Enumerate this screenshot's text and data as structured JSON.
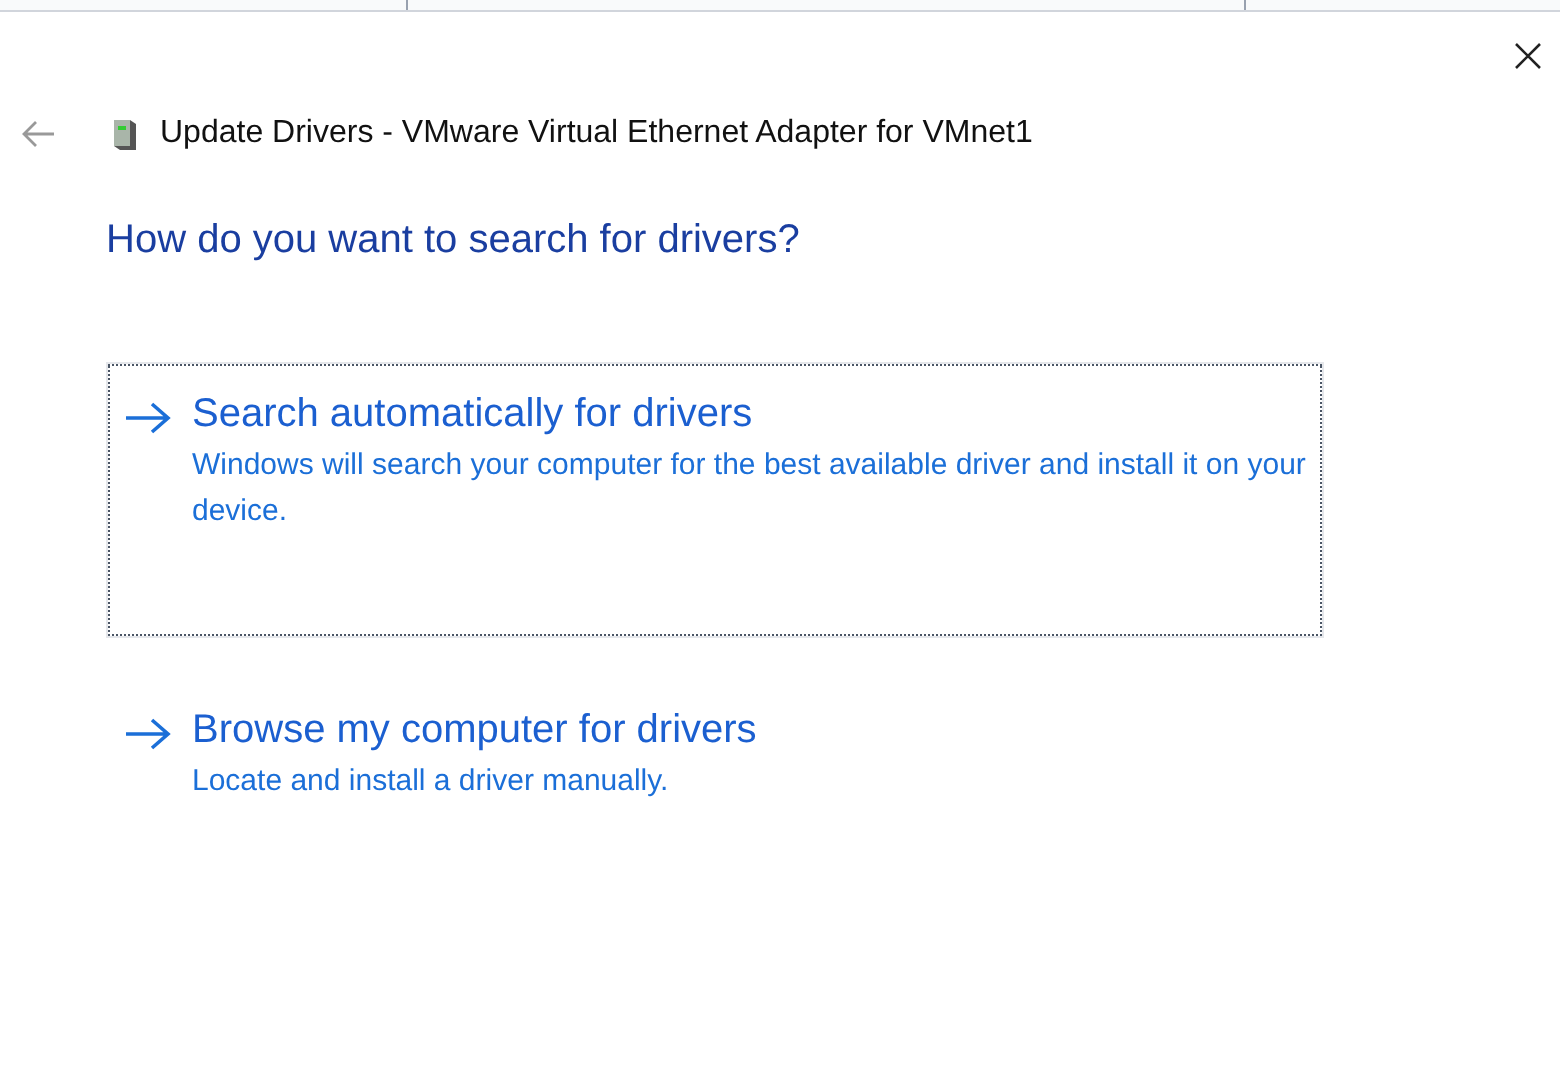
{
  "window": {
    "title": "Update Drivers - VMware Virtual Ethernet Adapter for VMnet1"
  },
  "heading": "How do you want to search for drivers?",
  "options": [
    {
      "title": "Search automatically for drivers",
      "description": "Windows will search your computer for the best available driver and install it on your device.",
      "focused": true
    },
    {
      "title": "Browse my computer for drivers",
      "description": "Locate and install a driver manually.",
      "focused": false
    }
  ]
}
